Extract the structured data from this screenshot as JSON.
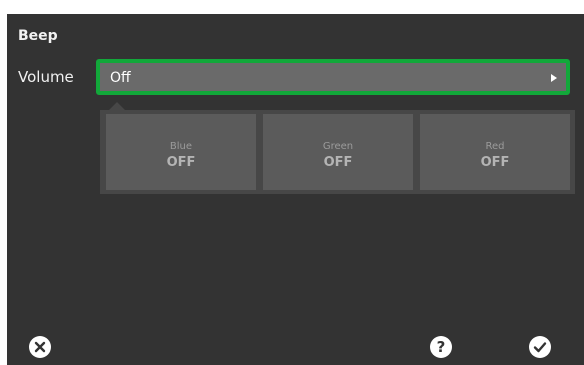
{
  "title": "Beep",
  "setting": {
    "label": "Volume",
    "value": "Off"
  },
  "options": [
    {
      "name": "Blue",
      "state": "OFF"
    },
    {
      "name": "Green",
      "state": "OFF"
    },
    {
      "name": "Red",
      "state": "OFF"
    }
  ],
  "footer": {
    "cancel_icon": "close-circle-icon",
    "help_icon": "help-circle-icon",
    "confirm_icon": "check-circle-icon"
  },
  "colors": {
    "background": "#333333",
    "select_border": "#12a83a",
    "select_fill": "#6a6a6a"
  }
}
